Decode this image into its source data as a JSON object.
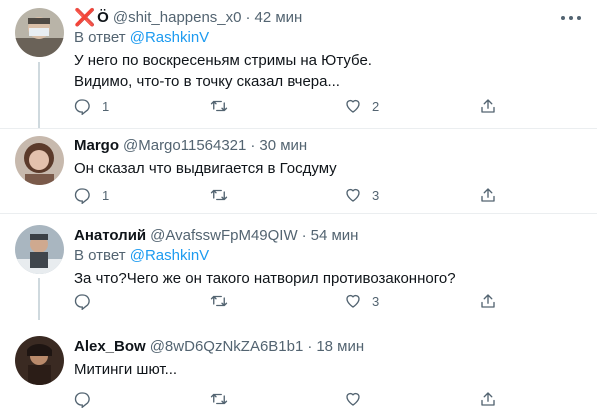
{
  "tweets": [
    {
      "name": "Ö",
      "name_prefix": "❌",
      "handle": "@shit_happens_x0",
      "sep": "·",
      "time": "42 мин",
      "reply_prefix": "В ответ",
      "reply_to": "@RashkinV",
      "lines": [
        "У него по воскресеньям стримы на Ютубе.",
        "Видимо, что-то в точку сказал вчера..."
      ],
      "replies": "1",
      "retweets": "",
      "likes": "2"
    },
    {
      "name": "Margo",
      "handle": "@Margo11564321",
      "sep": "·",
      "time": "30 мин",
      "lines": [
        "Он сказал что выдвигается в Госдуму"
      ],
      "replies": "1",
      "retweets": "",
      "likes": "3"
    },
    {
      "name": "Анатолий",
      "handle": "@AvafsswFpM49QIW",
      "sep": "·",
      "time": "54 мин",
      "reply_prefix": "В ответ",
      "reply_to": "@RashkinV",
      "lines": [
        "За что?Чего же он такого натворил противозаконного?"
      ],
      "replies": "",
      "retweets": "",
      "likes": "3"
    },
    {
      "name": "Alex_Bow",
      "handle": "@8wD6QzNkZA6B1b1",
      "sep": "·",
      "time": "18 мин",
      "lines": [
        "Митинги шют..."
      ],
      "replies": "",
      "retweets": "",
      "likes": ""
    }
  ],
  "icons": {
    "reply": "reply-icon",
    "retweet": "retweet-icon",
    "like": "like-icon",
    "share": "share-icon",
    "more": "more-icon"
  },
  "colors": {
    "link": "#1d9bf0",
    "secondary": "#536471",
    "x_mark": "#e0245e",
    "divider": "#ebeef0"
  }
}
